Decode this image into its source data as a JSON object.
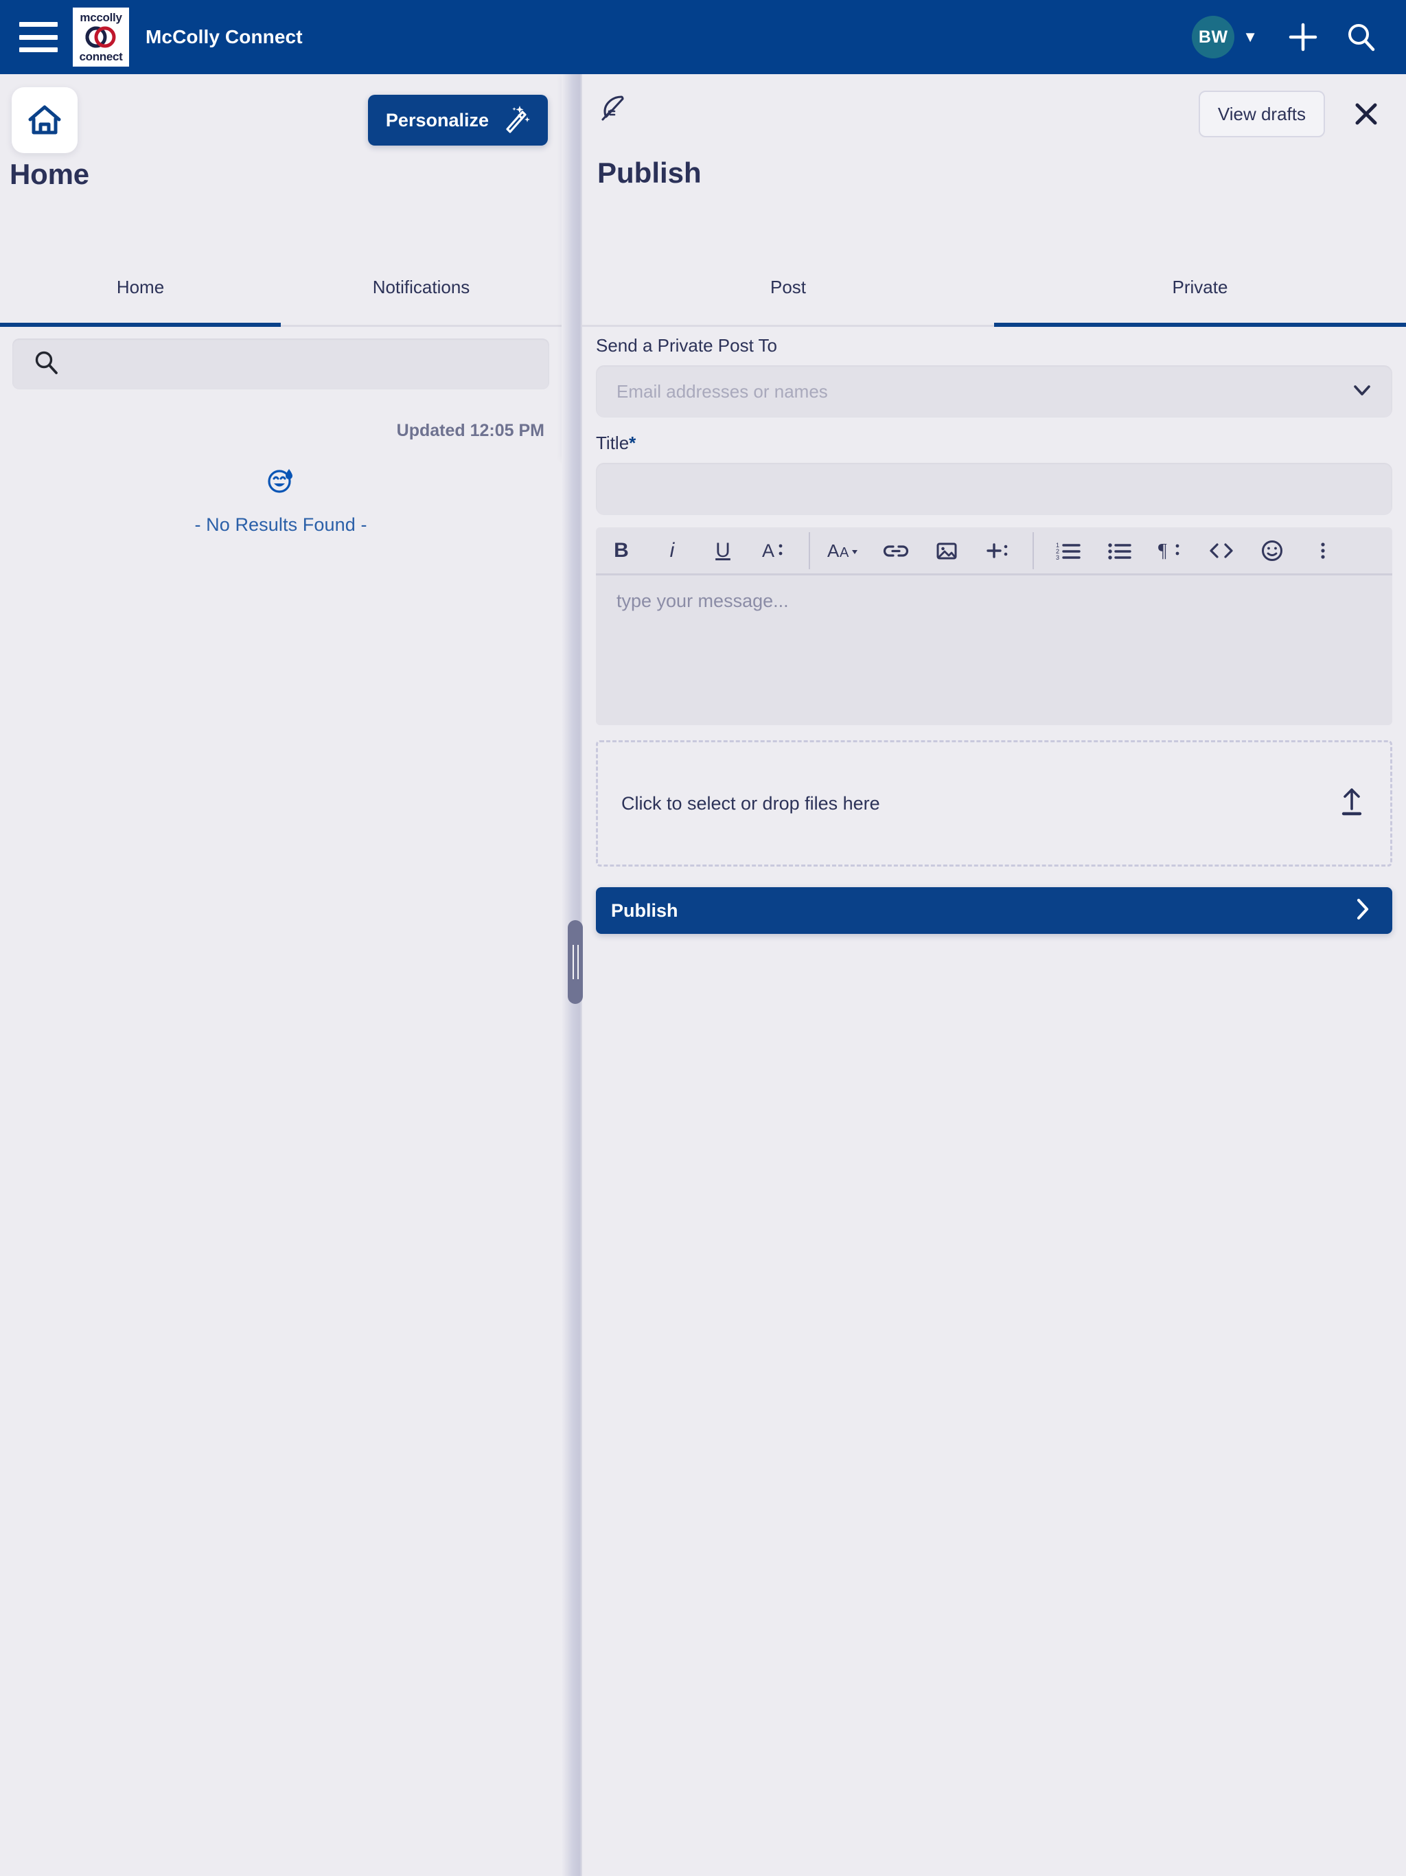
{
  "appbar": {
    "menu_icon": "hamburger-menu-icon",
    "logo_top_text": "mccolly",
    "logo_bottom_text": "connect",
    "app_title": "McColly Connect",
    "avatar_initials": "BW",
    "avatar_caret": "▼",
    "add_icon": "plus-icon",
    "search_icon": "search-icon",
    "brand_navy": "#03408c",
    "avatar_color": "#1b6e87"
  },
  "left_pane": {
    "home_icon": "home-icon",
    "personalize_label": "Personalize",
    "personalize_icon": "magic-wand-icon",
    "page_title": "Home",
    "tabs": [
      {
        "label": "Home",
        "active": true
      },
      {
        "label": "Notifications",
        "active": false
      }
    ],
    "search": {
      "icon": "search-icon",
      "value": "",
      "placeholder": ""
    },
    "updated_stamp": "Updated 12:05 PM",
    "empty_state": {
      "icon": "sweat-smile-emoji-icon",
      "text": "- No Results Found -"
    }
  },
  "publish_panel": {
    "header_icon": "quill-feather-icon",
    "view_drafts_label": "View drafts",
    "close_icon": "close-icon",
    "title": "Publish",
    "tabs": [
      {
        "label": "Post",
        "active": false
      },
      {
        "label": "Private",
        "active": true
      }
    ],
    "recipient": {
      "label": "Send a Private Post To",
      "placeholder": "Email addresses or names",
      "value": "",
      "chevron_icon": "chevron-down-icon"
    },
    "title_field": {
      "label": "Title",
      "required_marker": "*",
      "value": "",
      "placeholder": ""
    },
    "editor": {
      "placeholder": "type your message...",
      "value": "",
      "toolbar": [
        {
          "name": "bold-button",
          "glyph": "B",
          "kind": "text"
        },
        {
          "name": "italic-button",
          "glyph": "i",
          "kind": "italic"
        },
        {
          "name": "underline-button",
          "glyph": "U",
          "kind": "underline"
        },
        {
          "name": "text-color-button",
          "glyph": "A:",
          "kind": "icon"
        },
        {
          "name": "divider",
          "glyph": "",
          "kind": "divider"
        },
        {
          "name": "font-size-button",
          "glyph": "AA▾",
          "kind": "icon"
        },
        {
          "name": "link-button",
          "glyph": "link",
          "kind": "icon"
        },
        {
          "name": "image-button",
          "glyph": "image",
          "kind": "icon"
        },
        {
          "name": "insert-button",
          "glyph": "+:",
          "kind": "icon"
        },
        {
          "name": "divider",
          "glyph": "",
          "kind": "divider"
        },
        {
          "name": "ordered-list-button",
          "glyph": "123-list",
          "kind": "icon"
        },
        {
          "name": "bullet-list-button",
          "glyph": "bullet-list",
          "kind": "icon"
        },
        {
          "name": "paragraph-button",
          "glyph": "¶:",
          "kind": "icon"
        },
        {
          "name": "code-button",
          "glyph": "<>",
          "kind": "icon"
        },
        {
          "name": "emoji-button",
          "glyph": "smiley",
          "kind": "icon"
        },
        {
          "name": "more-options-button",
          "glyph": "⋮",
          "kind": "icon"
        }
      ]
    },
    "dropzone": {
      "text": "Click to select or drop files here",
      "icon": "upload-arrow-icon"
    },
    "publish_button": {
      "label": "Publish",
      "chevron_icon": "chevron-right-icon",
      "color": "#0a4189"
    }
  },
  "panel_resizer": {
    "name": "panel-drag-handle",
    "color": "#6f7393"
  },
  "theme": {
    "page_background": "#edecf1",
    "field_background": "#e2e1e8",
    "text_primary": "#2c3258",
    "accent_blue": "#0a4189",
    "link_blue": "#2a5fa8"
  }
}
